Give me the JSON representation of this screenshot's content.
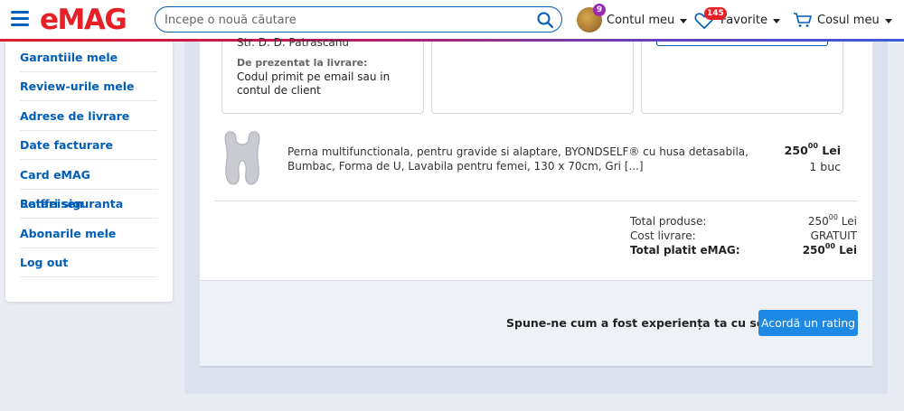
{
  "header": {
    "logo": "eMAG",
    "search_placeholder": "Începe o nouă căutare",
    "account_label": "Contul meu",
    "account_badge": "9",
    "favorites_label": "Favorite",
    "favorites_badge": "145",
    "cart_label": "Cosul meu",
    "brand_color": "#e52026",
    "accent_color": "#005eb8"
  },
  "sidebar": {
    "items": [
      {
        "label": "Garantiile mele"
      },
      {
        "label": "Review-urile mele"
      },
      {
        "label": "Adrese de livrare"
      },
      {
        "label": "Date facturare"
      },
      {
        "label": "Card eMAG Raiffeisen"
      },
      {
        "label": "Setari siguranta"
      },
      {
        "label": "Abonarile mele"
      },
      {
        "label": "Log out"
      }
    ]
  },
  "delivery": {
    "address_fragment": "Str. D. D. Patrascanu",
    "present_label": "De prezentat la livrare:",
    "present_text": "Codul primit pe email sau in contul de client"
  },
  "product": {
    "name": "Perna multifunctionala, pentru gravide si alaptare, BYONDSELF® cu husa detasabila, Bumbac, Forma de U, Lavabila pentru femei, 130 x 70cm, Gri [...]",
    "price_main": "250",
    "price_cents": "00",
    "currency": "Lei",
    "quantity": "1 buc"
  },
  "summary": {
    "products_label": "Total produse:",
    "products_value_main": "250",
    "products_value_cents": "00",
    "products_value_currency": "Lei",
    "shipping_label": "Cost livrare:",
    "shipping_value": "GRATUIT",
    "total_label": "Total platit eMAG:",
    "total_value_main": "250",
    "total_value_cents": "00",
    "total_value_currency": "Lei"
  },
  "rating": {
    "prompt": "Spune-ne cum a fost experiența ta cu seller-ul.",
    "button_label": "Acordă un rating"
  }
}
